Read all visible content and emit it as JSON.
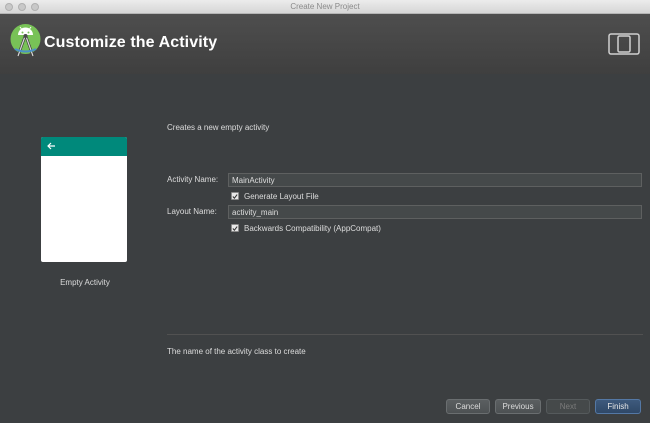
{
  "window": {
    "title": "Create New Project"
  },
  "header": {
    "title": "Customize the Activity",
    "logo_icon": "android-studio-icon",
    "device_icon": "tablet-phone-icon"
  },
  "template": {
    "name": "Empty Activity",
    "accent_color": "#00897b"
  },
  "form": {
    "description": "Creates a new empty activity",
    "activity_name_label": "Activity Name:",
    "activity_name_value": "MainActivity",
    "generate_layout_label": "Generate Layout File",
    "generate_layout_checked": true,
    "layout_name_label": "Layout Name:",
    "layout_name_value": "activity_main",
    "backwards_compat_label": "Backwards Compatibility (AppCompat)",
    "backwards_compat_checked": true
  },
  "hint": "The name of the activity class to create",
  "buttons": {
    "cancel": "Cancel",
    "previous": "Previous",
    "next": "Next",
    "finish": "Finish"
  }
}
